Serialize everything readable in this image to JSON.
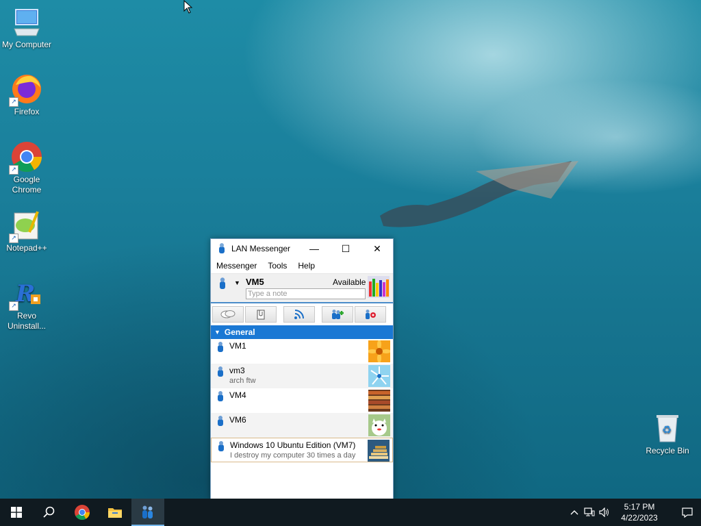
{
  "desktop": {
    "icons": [
      {
        "label": "My Computer"
      },
      {
        "label": "Firefox"
      },
      {
        "label": "Google Chrome"
      },
      {
        "label": "Notepad++"
      },
      {
        "label": "Revo Uninstall..."
      },
      {
        "label": "Recycle Bin"
      }
    ]
  },
  "window": {
    "title": "LAN Messenger",
    "menu": [
      "Messenger",
      "Tools",
      "Help"
    ],
    "user": {
      "name": "VM5",
      "status": "Available",
      "note_placeholder": "Type a note"
    },
    "toolbar": [
      "chat-icon",
      "file-transfer-icon",
      "broadcast-icon",
      "add-contact-icon",
      "settings-icon"
    ],
    "group": {
      "name": "General"
    },
    "contacts": [
      {
        "name": "VM1",
        "note": "",
        "avatar": "orange-flower"
      },
      {
        "name": "vm3",
        "note": "arch ftw",
        "avatar": "blue-windmill"
      },
      {
        "name": "VM4",
        "note": "",
        "avatar": "books"
      },
      {
        "name": "VM6",
        "note": "",
        "avatar": "lucky-cat"
      },
      {
        "name": "Windows 10 Ubuntu Edition (VM7)",
        "note": "I destroy my computer 30 times a day",
        "avatar": "stairs-books"
      }
    ]
  },
  "taskbar": {
    "items": [
      "start-icon",
      "search-icon",
      "chrome-icon",
      "file-explorer-icon",
      "lan-messenger-icon"
    ],
    "clock": {
      "time": "5:17 PM",
      "date": "4/22/2023"
    }
  }
}
